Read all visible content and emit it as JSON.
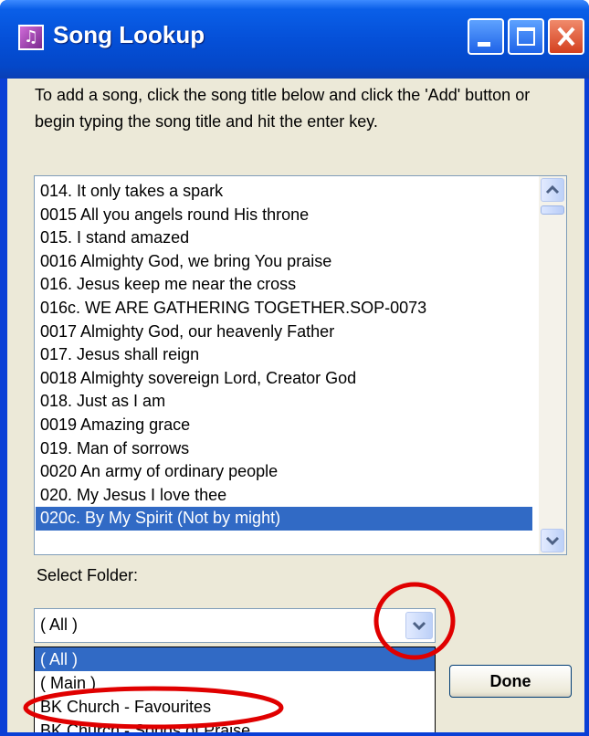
{
  "window": {
    "title": "Song Lookup",
    "icon": "music-note-icon"
  },
  "instructions": "To add a song, click the song title below and click the 'Add' button or begin typing the song title and hit the enter key.",
  "song_list": {
    "items": [
      "014. It only takes a spark",
      "0015 All you angels round His throne",
      "015. I stand amazed",
      "0016 Almighty God, we bring You praise",
      "016. Jesus keep me near the cross",
      "016c. WE ARE GATHERING TOGETHER.SOP-0073",
      "0017 Almighty God, our heavenly Father",
      "017. Jesus shall reign",
      "0018 Almighty sovereign Lord, Creator God",
      "018. Just as I am",
      "0019 Amazing grace",
      "019. Man of sorrows",
      "0020 An army of ordinary people",
      "020. My Jesus I love thee",
      "020c. By My Spirit (Not by might)"
    ],
    "selected_index": 14
  },
  "folder": {
    "label": "Select Folder:",
    "value": "( All )",
    "options": [
      "( All )",
      "( Main )",
      "BK Church - Favourites",
      "BK Church - Songs of Praise"
    ],
    "selected_index": 0
  },
  "buttons": {
    "done": "Done"
  },
  "colors": {
    "titlebar": "#0550d8",
    "selection": "#316ac5",
    "annotation": "#e00000",
    "face": "#ece9d8"
  }
}
